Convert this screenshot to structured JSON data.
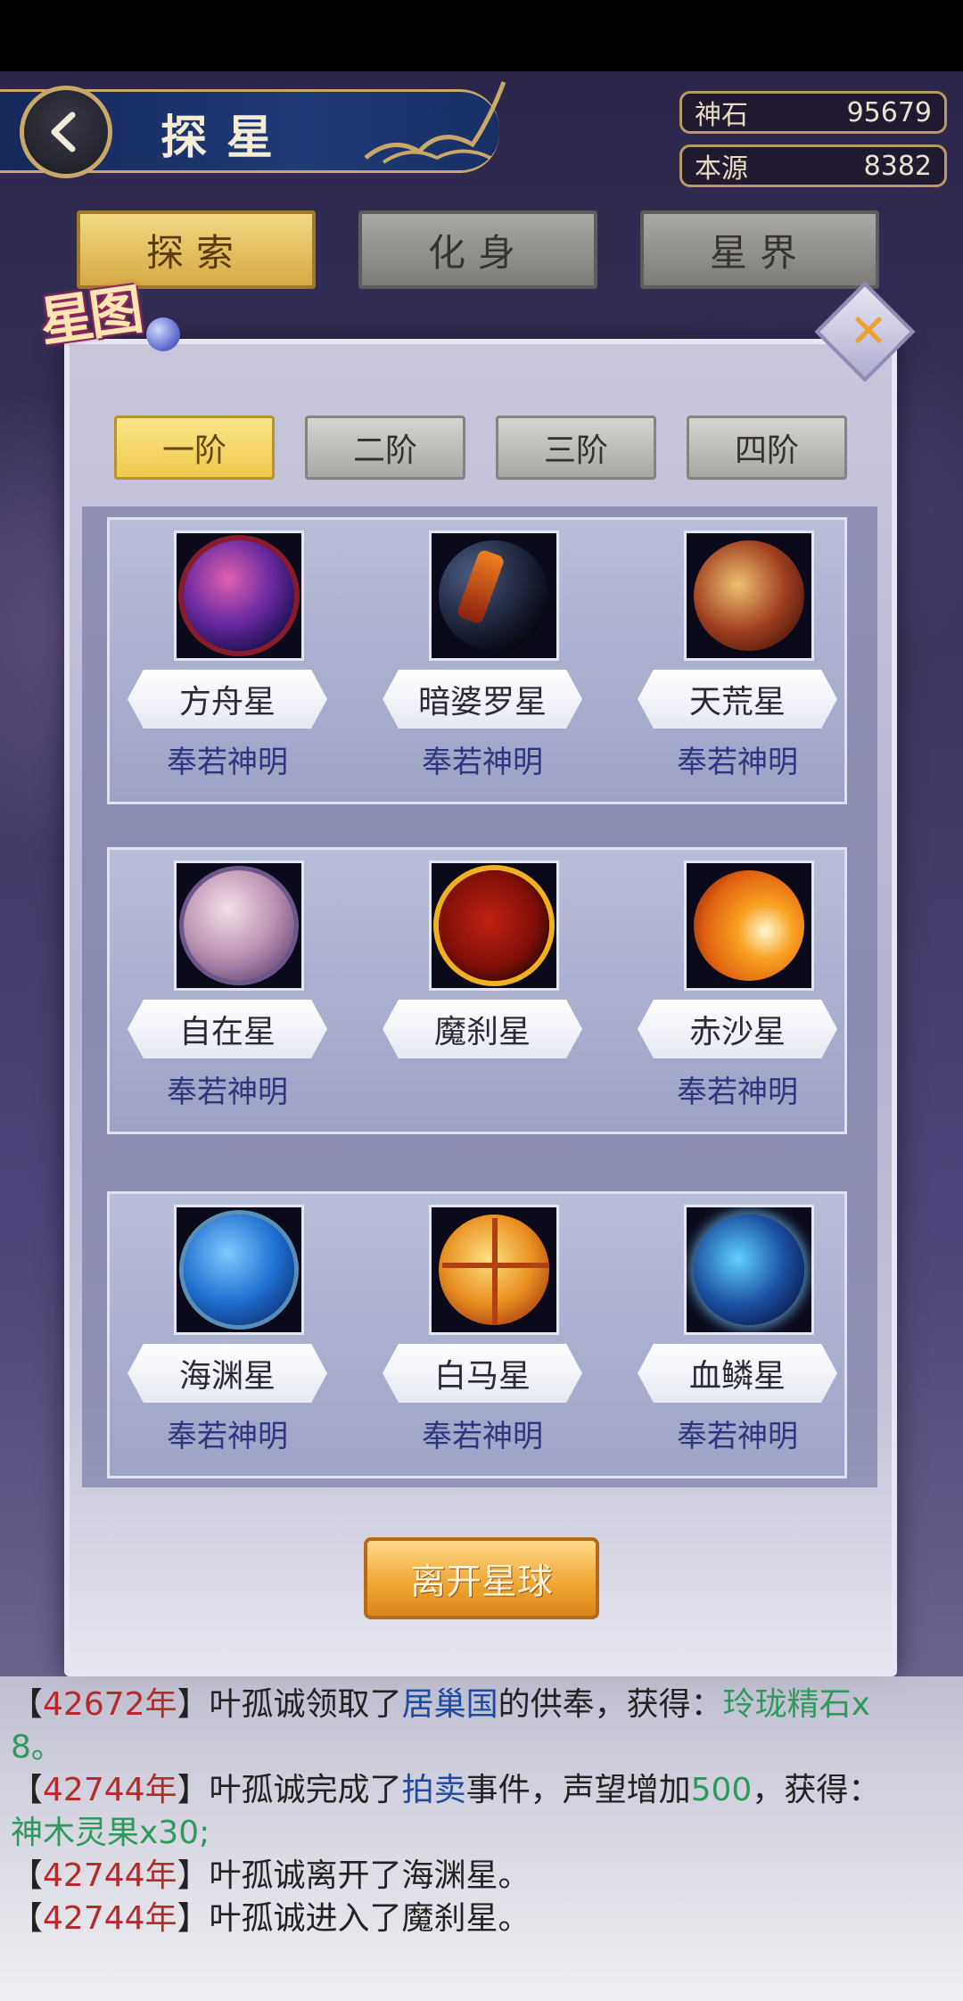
{
  "header": {
    "title": "探星",
    "resources": [
      {
        "label": "神石",
        "value": "95679"
      },
      {
        "label": "本源",
        "value": "8382"
      }
    ]
  },
  "main_tabs": [
    {
      "label": "探索",
      "active": true
    },
    {
      "label": "化身",
      "active": false
    },
    {
      "label": "星界",
      "active": false
    }
  ],
  "panel": {
    "badge": "星图",
    "tiers": [
      {
        "label": "一阶",
        "active": true
      },
      {
        "label": "二阶",
        "active": false
      },
      {
        "label": "三阶",
        "active": false
      },
      {
        "label": "四阶",
        "active": false
      }
    ],
    "rows": [
      [
        {
          "name": "方舟星",
          "status": "奉若神明",
          "icon": "nebula-planet-icon"
        },
        {
          "name": "暗婆罗星",
          "status": "奉若神明",
          "icon": "dark-planet-icon"
        },
        {
          "name": "天荒星",
          "status": "奉若神明",
          "icon": "cracked-planet-icon"
        }
      ],
      [
        {
          "name": "自在星",
          "status": "奉若神明",
          "icon": "ringed-pink-planet-icon"
        },
        {
          "name": "魔刹星",
          "status": "",
          "icon": "red-eclipse-planet-icon"
        },
        {
          "name": "赤沙星",
          "status": "奉若神明",
          "icon": "orange-sun-planet-icon"
        }
      ],
      [
        {
          "name": "海渊星",
          "status": "奉若神明",
          "icon": "blue-ringed-planet-icon"
        },
        {
          "name": "白马星",
          "status": "奉若神明",
          "icon": "golden-planet-icon"
        },
        {
          "name": "血鳞星",
          "status": "奉若神明",
          "icon": "glowing-blue-planet-icon"
        }
      ]
    ],
    "leave_button": "离开星球"
  },
  "log": {
    "line0_prefix": "【",
    "line0_year": "42672年",
    "line0_text": "】叶孤诚领取了",
    "line0_country": "居巢国",
    "line0_text2": "的供奉，获得：",
    "line0_item": "玲珑精石x",
    "line1": "8。",
    "line2_prefix": "【",
    "line2_year": "42744年",
    "line2_text": "】叶孤诚完成了",
    "line2_event": "拍卖",
    "line2_text2": "事件，声望增加",
    "line2_amount": "500",
    "line2_text3": "，获得：",
    "line3_item": "神木灵果x30;",
    "line4_prefix": "【",
    "line4_year": "42744年",
    "line4_text": "】叶孤诚离开了海渊星。",
    "line5_prefix": "【",
    "line5_year": "42744年",
    "line5_text": "】叶孤诚进入了魔刹星。"
  },
  "colors": {
    "active_tab": "#d6a943",
    "faith_text": "#2f3680",
    "year_text": "#b52a2a",
    "reward_text": "#2d9a5c"
  }
}
